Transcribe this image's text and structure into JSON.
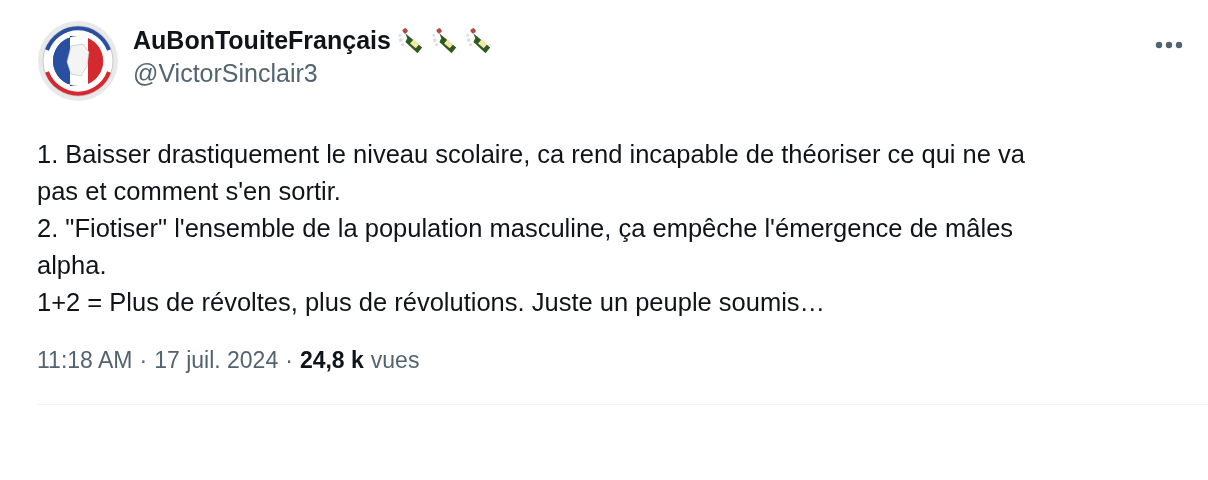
{
  "author": {
    "name": "AuBonTouiteFrançais",
    "handle": "@VictorSinclair3"
  },
  "body": "1. Baisser drastiquement le niveau scolaire, ca rend incapable de théoriser ce qui ne va pas et comment s'en sortir.\n2. \"Fiotiser\" l'ensemble de la population masculine, ça empêche l'émergence de mâles alpha.\n1+2 = Plus de révoltes, plus de révolutions. Juste un peuple soumis…",
  "footer": {
    "time": "11:18 AM",
    "separator_1": "·",
    "date": "17 juil. 2024",
    "separator_2": "·",
    "views": "24,8 k",
    "views_label": "vues"
  }
}
